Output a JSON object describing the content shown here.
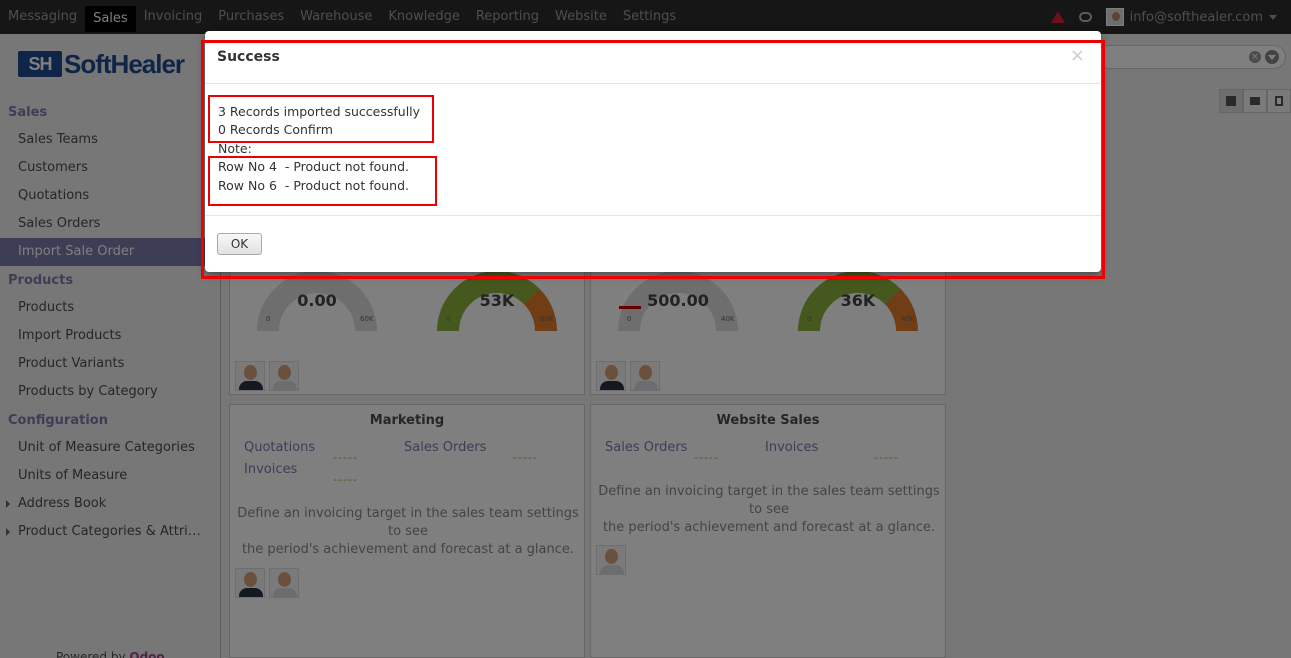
{
  "navbar": {
    "items": [
      "Messaging",
      "Sales",
      "Invoicing",
      "Purchases",
      "Warehouse",
      "Knowledge",
      "Reporting",
      "Website",
      "Settings"
    ],
    "active": "Sales",
    "user_email": "info@softhealer.com"
  },
  "logo": {
    "text": "Soft Healer",
    "mark": "SH"
  },
  "sidebar": {
    "sales_heading": "Sales",
    "sales_items": [
      "Sales Teams",
      "Customers",
      "Quotations",
      "Sales Orders",
      "Import Sale Order"
    ],
    "products_heading": "Products",
    "products_items": [
      "Products",
      "Import Products",
      "Product Variants",
      "Products by Category"
    ],
    "config_heading": "Configuration",
    "config_items": [
      "Unit of Measure Categories",
      "Units of Measure",
      "Address Book",
      "Product Categories & Attri…"
    ],
    "powered_prefix": "Powered by ",
    "powered_brand": "Odoo"
  },
  "gauges": [
    {
      "value": "0.00",
      "min": "0",
      "max": "60K"
    },
    {
      "value": "53K",
      "min": "0",
      "max": "60K"
    },
    {
      "value": "500.00",
      "min": "0",
      "max": "40K"
    },
    {
      "value": "36K",
      "min": "0",
      "max": "40K"
    }
  ],
  "cards": {
    "marketing": {
      "title": "Marketing",
      "link_quotations": "Quotations",
      "link_sales_orders": "Sales Orders",
      "link_invoices": "Invoices",
      "desc_line1": "Define an invoicing target in the sales team settings to see",
      "desc_line2": "the period's achievement and forecast at a glance."
    },
    "website": {
      "title": "Website Sales",
      "link_sales_orders": "Sales Orders",
      "link_invoices": "Invoices",
      "desc_line1": "Define an invoicing target in the sales team settings to see",
      "desc_line2": "the period's achievement and forecast at a glance."
    },
    "dash": "-----"
  },
  "modal": {
    "title": "Success",
    "close": "×",
    "line1": "3 Records imported successfully",
    "line2": "0 Records Confirm",
    "note_label": "Note:",
    "row1": "Row No 4  - Product not found.",
    "row2": "Row No 6  - Product not found.",
    "ok_label": "OK"
  },
  "colors": {
    "accent": "#7c7bad",
    "highlight": "#e00000",
    "gauge_fill": "#8bb13a"
  }
}
